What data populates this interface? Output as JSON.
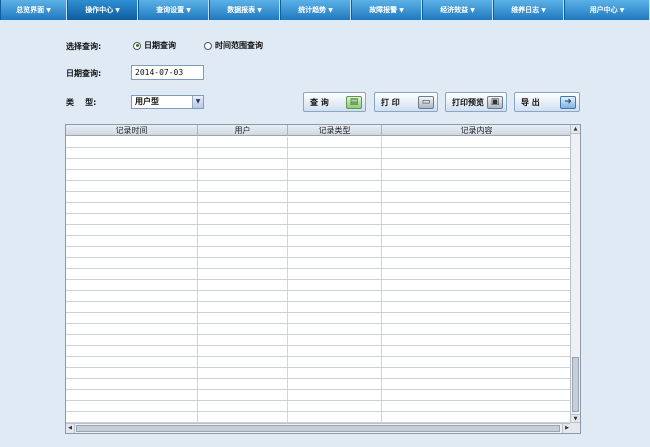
{
  "nav": {
    "items": [
      {
        "label": "总览界面",
        "active": false
      },
      {
        "label": "操作中心",
        "active": true
      },
      {
        "label": "查询设置",
        "active": false
      },
      {
        "label": "数据报表",
        "active": false
      },
      {
        "label": "统计趋势",
        "active": false
      },
      {
        "label": "故障报警",
        "active": false
      },
      {
        "label": "经济效益",
        "active": false
      },
      {
        "label": "维养日志",
        "active": false
      },
      {
        "label": "用户中心",
        "active": false
      }
    ]
  },
  "form": {
    "query_mode_label": "选择查询:",
    "radio_date": "日期查询",
    "radio_range": "时间范围查询",
    "date_label": "日期查询:",
    "date_value": "2014-07-03",
    "type_label": "类    型:",
    "type_value": "用户型"
  },
  "buttons": {
    "query": "查 询",
    "print": "打 印",
    "preview": "打印预览",
    "export": "导 出"
  },
  "table": {
    "columns": [
      "记录时间",
      "用户",
      "记录类型",
      "记录内容"
    ],
    "rows": []
  }
}
